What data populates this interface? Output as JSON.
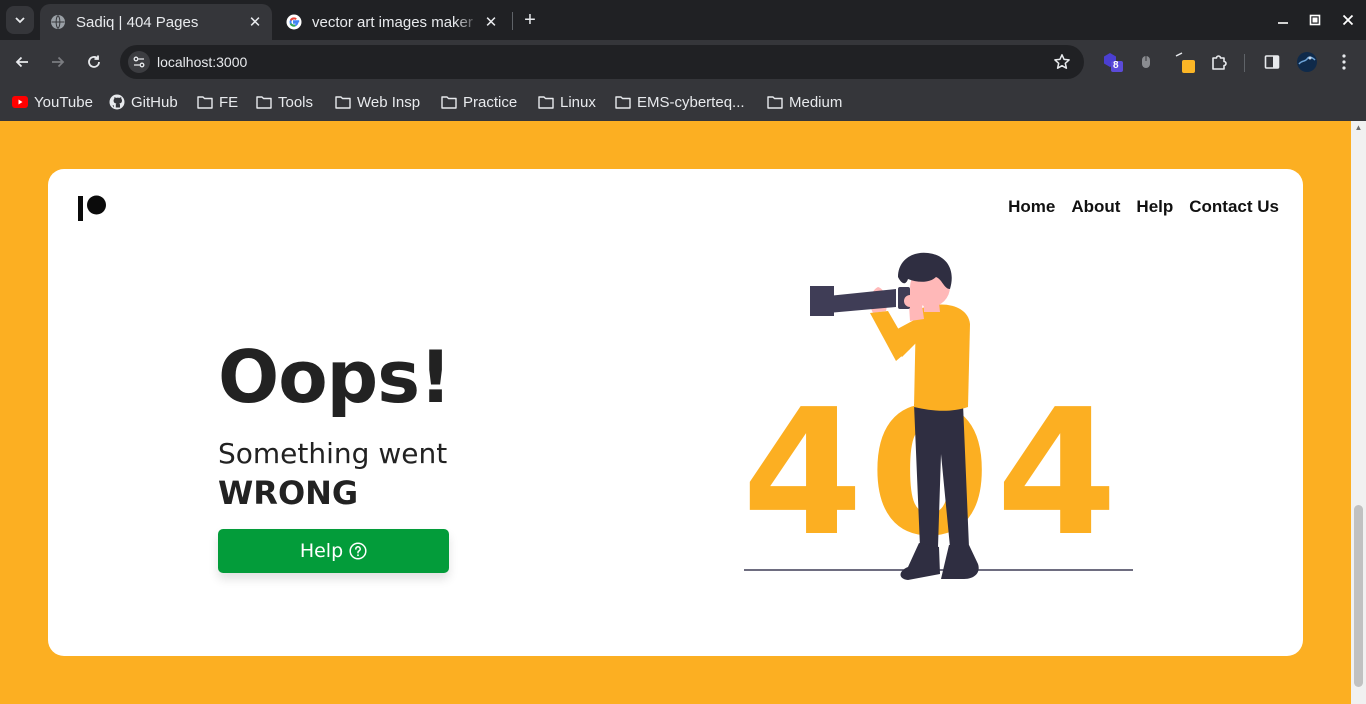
{
  "browser": {
    "tabs": [
      {
        "title": "Sadiq | 404 Pages",
        "active": true,
        "favicon": "globe-icon"
      },
      {
        "title": "vector art images maker",
        "active": false,
        "favicon": "google-icon"
      }
    ],
    "new_tab_label": "+",
    "url": "localhost:3000",
    "extension_badge": "8",
    "bookmarks": [
      {
        "label": "YouTube",
        "icon": "youtube-icon"
      },
      {
        "label": "GitHub",
        "icon": "github-icon"
      },
      {
        "label": "FE",
        "icon": "folder-icon"
      },
      {
        "label": "Tools",
        "icon": "folder-icon"
      },
      {
        "label": "Web Insp",
        "icon": "folder-icon"
      },
      {
        "label": "Practice",
        "icon": "folder-icon"
      },
      {
        "label": "Linux",
        "icon": "folder-icon"
      },
      {
        "label": "EMS-cyberteq...",
        "icon": "folder-icon"
      },
      {
        "label": "Medium",
        "icon": "folder-icon"
      }
    ]
  },
  "page": {
    "nav": [
      "Home",
      "About",
      "Help",
      "Contact Us"
    ],
    "headline": "Oops!",
    "subtitle_line1": "Something went",
    "subtitle_line2": "WRONG",
    "help_button": "Help",
    "error_code": "404"
  },
  "colors": {
    "page_background": "#fcaf22",
    "help_button": "#039c3a",
    "browser_dark": "#202124",
    "browser_toolbar": "#35363a"
  }
}
